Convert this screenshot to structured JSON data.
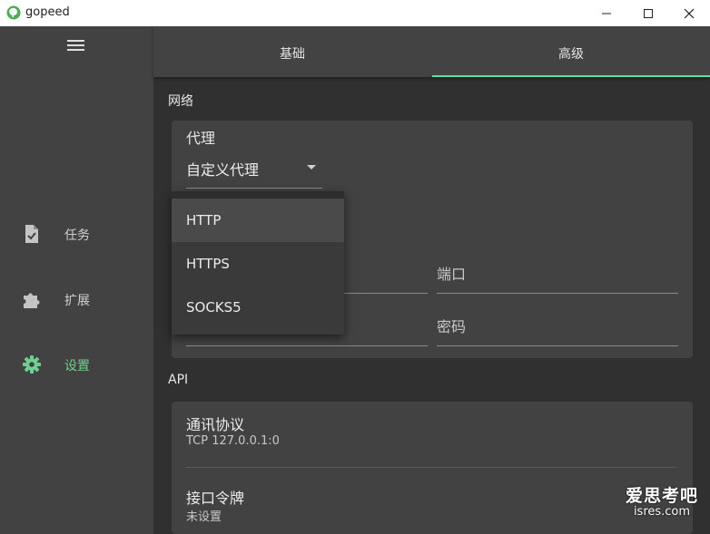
{
  "app": {
    "title": "gopeed"
  },
  "sidebar": {
    "items": [
      {
        "label": "任务",
        "icon": "task-file-icon"
      },
      {
        "label": "扩展",
        "icon": "puzzle-icon"
      },
      {
        "label": "设置",
        "icon": "gear-icon",
        "active": true
      }
    ]
  },
  "tabs": [
    {
      "label": "基础"
    },
    {
      "label": "高级",
      "active": true
    }
  ],
  "network": {
    "section_title": "网络",
    "proxy": {
      "label": "代理",
      "selected": "自定义代理",
      "options": [
        "HTTP",
        "HTTPS",
        "SOCKS5"
      ],
      "hovered_option": "HTTP"
    },
    "port_placeholder": "端口",
    "password_placeholder": "密码"
  },
  "api": {
    "section_title": "API",
    "protocol": {
      "title": "通讯协议",
      "value": "TCP 127.0.0.1:0"
    },
    "token": {
      "title": "接口令牌",
      "value": "未设置"
    }
  },
  "watermark": {
    "line1": "爱思考吧",
    "line2": "isres.com"
  },
  "colors": {
    "accent": "#58e0a8",
    "active_nav": "#6fd18f"
  }
}
